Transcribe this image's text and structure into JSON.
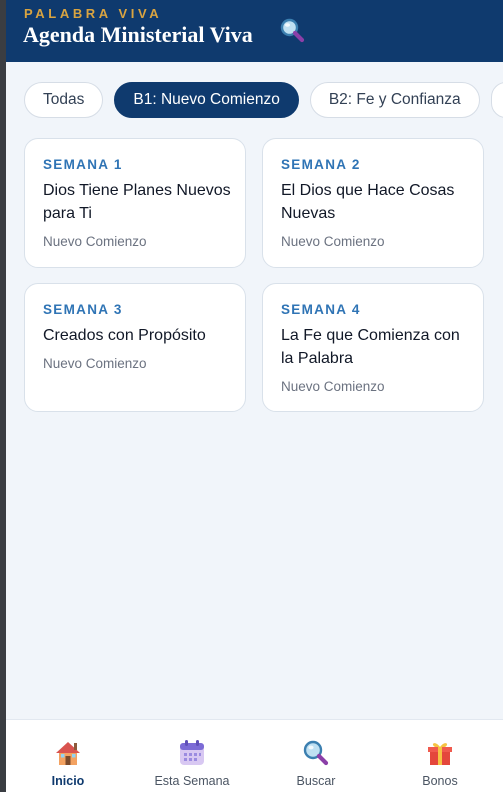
{
  "header": {
    "kicker": "PALABRA VIVA",
    "title": "Agenda Ministerial Viva",
    "search_icon": "magnifier-icon"
  },
  "filters": [
    {
      "label": "Todas",
      "active": false
    },
    {
      "label": "B1: Nuevo Comienzo",
      "active": true
    },
    {
      "label": "B2: Fe y Confianza",
      "active": false
    }
  ],
  "cards": [
    {
      "week": "SEMANA 1",
      "title": "Dios Tiene Planes Nuevos para Ti",
      "subtitle": "Nuevo Comienzo"
    },
    {
      "week": "SEMANA 2",
      "title": "El Dios que Hace Cosas Nuevas",
      "subtitle": "Nuevo Comienzo"
    },
    {
      "week": "SEMANA 3",
      "title": "Creados con Propósito",
      "subtitle": "Nuevo Comienzo"
    },
    {
      "week": "SEMANA 4",
      "title": "La Fe que Comienza con la Palabra",
      "subtitle": "Nuevo Comienzo"
    }
  ],
  "nav": [
    {
      "label": "Inicio",
      "icon": "house-icon",
      "active": true
    },
    {
      "label": "Esta Semana",
      "icon": "calendar-icon",
      "active": false
    },
    {
      "label": "Buscar",
      "icon": "magnifier-icon",
      "active": false
    },
    {
      "label": "Bonos",
      "icon": "gift-icon",
      "active": false
    }
  ],
  "colors": {
    "brand": "#0f3a6e",
    "accent": "#d9a441",
    "week_label": "#2f74b5",
    "background": "#f1f5fa"
  }
}
